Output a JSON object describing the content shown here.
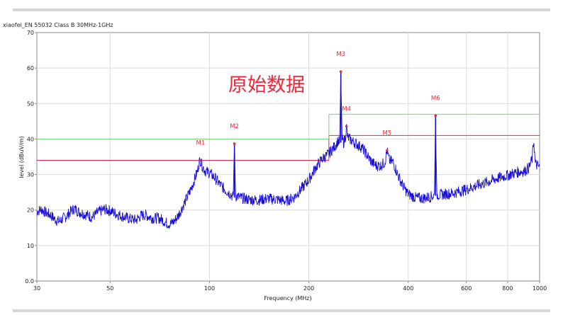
{
  "chart_data": {
    "type": "line",
    "title": "xiaofei_EN 55032 Class B 30MHz-1GHz",
    "overlay_text": "原始数据",
    "xlabel": "Frequency (MHz)",
    "ylabel": "level (dBuV/m)",
    "xscale": "log",
    "xlim": [
      30,
      1000
    ],
    "ylim": [
      0,
      70
    ],
    "x_ticks": [
      30,
      50,
      100,
      200,
      400,
      600,
      800,
      1000
    ],
    "y_ticks": [
      "0.0",
      "10",
      "20",
      "30",
      "40",
      "50",
      "60",
      "70"
    ],
    "grid": true,
    "series": [
      {
        "color": "#1a0fd6",
        "points": [
          [
            30,
            19.6
          ],
          [
            31,
            20.2
          ],
          [
            32,
            19.2
          ],
          [
            33,
            18.6
          ],
          [
            34,
            17.4
          ],
          [
            35,
            16.8
          ],
          [
            36,
            17.6
          ],
          [
            37,
            18.4
          ],
          [
            38,
            19.6
          ],
          [
            39,
            20.4
          ],
          [
            40,
            19.6
          ],
          [
            42,
            18.8
          ],
          [
            44,
            18.0
          ],
          [
            45,
            18.6
          ],
          [
            46,
            19.4
          ],
          [
            48,
            20.2
          ],
          [
            50,
            19.8
          ],
          [
            52,
            19.0
          ],
          [
            54,
            18.4
          ],
          [
            56,
            17.8
          ],
          [
            58,
            17.4
          ],
          [
            60,
            17.2
          ],
          [
            62,
            18.4
          ],
          [
            64,
            18.6
          ],
          [
            66,
            18.0
          ],
          [
            68,
            17.6
          ],
          [
            70,
            17.8
          ],
          [
            72,
            17.2
          ],
          [
            74,
            16.4
          ],
          [
            76,
            16.0
          ],
          [
            78,
            16.8
          ],
          [
            80,
            18.0
          ],
          [
            82,
            20.0
          ],
          [
            84,
            22.0
          ],
          [
            86,
            24.0
          ],
          [
            88,
            26.0
          ],
          [
            90,
            28.5
          ],
          [
            92,
            31.0
          ],
          [
            93,
            33.5
          ],
          [
            94,
            34.0
          ],
          [
            95,
            32.5
          ],
          [
            97,
            31.0
          ],
          [
            100,
            30.5
          ],
          [
            104,
            29.0
          ],
          [
            108,
            27.0
          ],
          [
            112,
            25.5
          ],
          [
            116,
            24.5
          ],
          [
            118,
            23.5
          ],
          [
            119,
            38.7
          ],
          [
            120,
            24.0
          ],
          [
            124,
            23.5
          ],
          [
            130,
            23.0
          ],
          [
            140,
            22.8
          ],
          [
            150,
            23.2
          ],
          [
            160,
            23.0
          ],
          [
            170,
            22.5
          ],
          [
            180,
            23.5
          ],
          [
            190,
            26.0
          ],
          [
            200,
            28.5
          ],
          [
            210,
            32.0
          ],
          [
            220,
            34.5
          ],
          [
            228,
            35.5
          ],
          [
            235,
            37.0
          ],
          [
            240,
            38.0
          ],
          [
            245,
            39.5
          ],
          [
            248,
            39.0
          ],
          [
            250,
            59.0
          ],
          [
            252,
            40.0
          ],
          [
            255,
            39.0
          ],
          [
            258,
            40.5
          ],
          [
            260,
            43.6
          ],
          [
            262,
            40.5
          ],
          [
            270,
            39.5
          ],
          [
            280,
            38.5
          ],
          [
            290,
            37.5
          ],
          [
            300,
            35.5
          ],
          [
            310,
            33.5
          ],
          [
            320,
            32.5
          ],
          [
            330,
            32.5
          ],
          [
            340,
            33.5
          ],
          [
            345,
            36.8
          ],
          [
            350,
            34.0
          ],
          [
            360,
            33.5
          ],
          [
            370,
            30.5
          ],
          [
            380,
            28.0
          ],
          [
            390,
            26.0
          ],
          [
            400,
            24.5
          ],
          [
            420,
            23.5
          ],
          [
            440,
            23.3
          ],
          [
            460,
            23.6
          ],
          [
            480,
            24.0
          ],
          [
            484,
            46.6
          ],
          [
            488,
            24.2
          ],
          [
            500,
            24.3
          ],
          [
            550,
            24.8
          ],
          [
            600,
            25.8
          ],
          [
            650,
            27.0
          ],
          [
            700,
            28.0
          ],
          [
            750,
            29.0
          ],
          [
            800,
            29.8
          ],
          [
            850,
            30.6
          ],
          [
            900,
            31.0
          ],
          [
            930,
            32.0
          ],
          [
            950,
            34.5
          ],
          [
            960,
            40.0
          ],
          [
            970,
            33.0
          ],
          [
            1000,
            32.0
          ]
        ]
      }
    ],
    "limit_lines": [
      {
        "color": "#e02a50",
        "segments": [
          [
            [
              30,
              34
            ],
            [
              230,
              34
            ]
          ],
          [
            [
              230,
              41
            ],
            [
              1000,
              41
            ]
          ]
        ]
      },
      {
        "color": "#6fd86f",
        "segments": [
          [
            [
              30,
              40
            ],
            [
              230,
              40
            ]
          ],
          [
            [
              230,
              47
            ],
            [
              1000,
              47
            ]
          ]
        ]
      }
    ],
    "markers": [
      {
        "label": "M1",
        "x": 94,
        "y": 34.0
      },
      {
        "label": "M2",
        "x": 119,
        "y": 38.7
      },
      {
        "label": "M3",
        "x": 250,
        "y": 59.0
      },
      {
        "label": "M4",
        "x": 260,
        "y": 43.6
      },
      {
        "label": "M5",
        "x": 345,
        "y": 36.8
      },
      {
        "label": "M6",
        "x": 484,
        "y": 46.6
      }
    ],
    "colors": {
      "trace": "#1a0fd6",
      "marker": "#e8283c",
      "overlay_text": "#f0283c"
    }
  }
}
